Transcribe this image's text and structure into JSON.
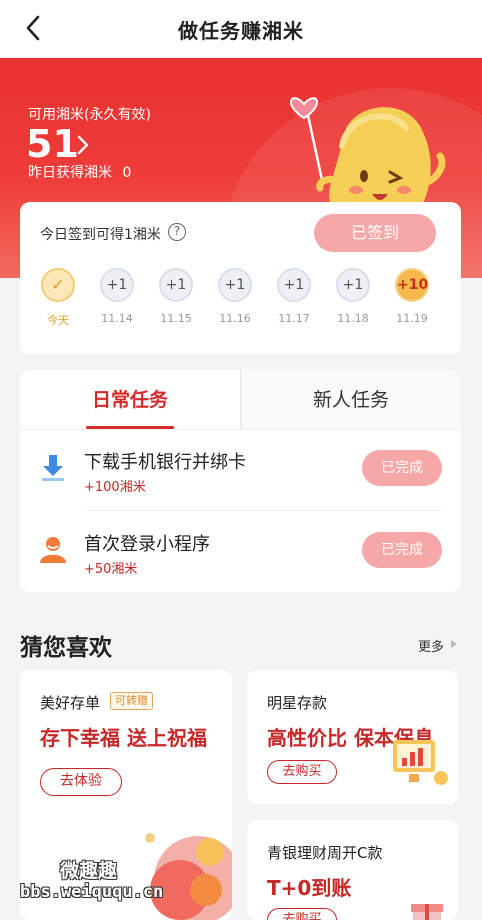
{
  "nav": {
    "title": "做任务赚湘米",
    "back_icon": "chevron-left-icon"
  },
  "hero": {
    "balance_label": "可用湘米(永久有效)",
    "balance_value": "51",
    "yesterday_label": "昨日获得湘米",
    "yesterday_value": "0",
    "bg_color": "#e8312f"
  },
  "sign_in": {
    "tip": "今日签到可得1湘米",
    "help_icon": "question-circle-icon",
    "button_label": "已签到",
    "days": [
      {
        "reward": "✓",
        "label": "今天",
        "state": "checked"
      },
      {
        "reward": "+1",
        "label": "11.14",
        "state": "normal"
      },
      {
        "reward": "+1",
        "label": "11.15",
        "state": "normal"
      },
      {
        "reward": "+1",
        "label": "11.16",
        "state": "normal"
      },
      {
        "reward": "+1",
        "label": "11.17",
        "state": "normal"
      },
      {
        "reward": "+1",
        "label": "11.18",
        "state": "normal"
      },
      {
        "reward": "+10",
        "label": "11.19",
        "state": "bonus"
      }
    ]
  },
  "tasks": {
    "tabs": [
      {
        "label": "日常任务",
        "active": true
      },
      {
        "label": "新人任务",
        "active": false
      }
    ],
    "items": [
      {
        "title": "下载手机银行并绑卡",
        "reward": "+100湘米",
        "button": "已完成",
        "icon": "download-icon"
      },
      {
        "title": "首次登录小程序",
        "reward": "+50湘米",
        "button": "已完成",
        "icon": "user-avatar-icon"
      }
    ]
  },
  "recommend": {
    "title": "猜您喜欢",
    "more_label": "更多",
    "products": [
      {
        "name": "美好存单",
        "tag": "可转赠",
        "slogan": "存下幸福 送上祝福",
        "button": "去体验"
      },
      {
        "name": "明星存款",
        "slogan": "高性价比 保本保息",
        "button": "去购买"
      },
      {
        "name": "青银理财周开C款",
        "slogan": "T+0到账",
        "button": "去购买"
      }
    ]
  },
  "watermark": {
    "line1": "微趣趣",
    "line2": "bbs.weiququ.cn"
  },
  "colors": {
    "accent": "#d42a2a",
    "disabled_button": "#f6a7a7",
    "gold": "#f6b84b"
  }
}
